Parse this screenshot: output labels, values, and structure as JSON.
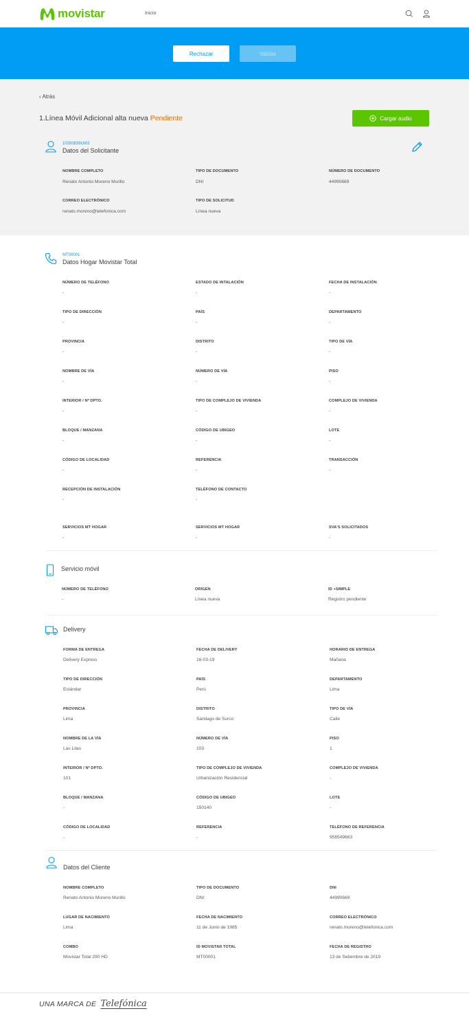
{
  "header": {
    "brand": "movistar",
    "nav_inicio": "Inicio",
    "brand_color": "#5bc500"
  },
  "actions": {
    "reject": "Rechazar",
    "validate": "Validar",
    "band_color": "#019df4"
  },
  "page": {
    "back": "‹ Atrás",
    "title": "1.Línea Móvil Adicional alta nueva",
    "status": "Pendiente",
    "status_color": "#e66c00",
    "upload_audio": "Cargar audio"
  },
  "solicitante": {
    "code": "10283839ch02",
    "title": "Datos del Solicitante",
    "fields": [
      {
        "label": "Nombre completo",
        "value": "Renato Antonio Moreno Murillo"
      },
      {
        "label": "Tipo de documento",
        "value": "DNI"
      },
      {
        "label": "Número de documento",
        "value": "44990669"
      },
      {
        "label": "Correo electrónico",
        "value": "renato.moreno@telefonica.com"
      },
      {
        "label": "Tipo de solicitud",
        "value": "Línea nueva"
      }
    ]
  },
  "hogar": {
    "code": "MT00001",
    "title": "Datos Hogar Movistar Total",
    "fields": [
      {
        "label": "Número de teléfono",
        "value": "-"
      },
      {
        "label": "Estado de intalación",
        "value": "-"
      },
      {
        "label": "Fecha de instalación",
        "value": "-"
      },
      {
        "label": "Tipo de dirección",
        "value": "-"
      },
      {
        "label": "País",
        "value": "-"
      },
      {
        "label": "Departamento",
        "value": "-"
      },
      {
        "label": "Provincia",
        "value": "-"
      },
      {
        "label": "Distrito",
        "value": "-"
      },
      {
        "label": "Tipo de vía",
        "value": "-"
      },
      {
        "label": "Nombre de vía",
        "value": "-"
      },
      {
        "label": "Número de vía",
        "value": "-"
      },
      {
        "label": "Piso",
        "value": "-"
      },
      {
        "label": "Interior / Nº Dpto.",
        "value": "-"
      },
      {
        "label": "Tipo de complejo de vivienda",
        "value": "-"
      },
      {
        "label": "Complejo de vivienda",
        "value": "-"
      },
      {
        "label": "Bloque / Manzana",
        "value": "-"
      },
      {
        "label": "Código de ubigeo",
        "value": "-"
      },
      {
        "label": "Lote",
        "value": "-"
      },
      {
        "label": "Código de localidad",
        "value": "-"
      },
      {
        "label": "Referencia",
        "value": "-"
      },
      {
        "label": "Transacción",
        "value": "-"
      },
      {
        "label": "Recepción de instalación",
        "value": "-"
      },
      {
        "label": "Teléfono de contacto",
        "value": "-"
      },
      {
        "label": "Servicios MT Hogar",
        "value": "-"
      },
      {
        "label": "Servicios MT Hogar",
        "value": "-"
      },
      {
        "label": "SVA's solicitados",
        "value": "-"
      }
    ]
  },
  "movil": {
    "title": "Servicio móvil",
    "fields": [
      {
        "label": "Número de teléfono",
        "value": "-"
      },
      {
        "label": "Origen",
        "value": "Línea nueva"
      },
      {
        "label": "ID +Simple",
        "value": "Registro pendiente"
      }
    ]
  },
  "delivery": {
    "title": "Delivery",
    "fields": [
      {
        "label": "Forma de entrega",
        "value": "Delivery Express"
      },
      {
        "label": "Fecha de delivery",
        "value": "16-03-19"
      },
      {
        "label": "Horario de entrega",
        "value": "Mañana"
      },
      {
        "label": "Tipo de dirección",
        "value": "Estándar"
      },
      {
        "label": "País",
        "value": "Perú"
      },
      {
        "label": "Departamento",
        "value": "Lima"
      },
      {
        "label": "Provincia",
        "value": "Lima"
      },
      {
        "label": "Distrito",
        "value": "Santiago de Surco"
      },
      {
        "label": "Tipo de vía",
        "value": "Calle"
      },
      {
        "label": "Nombre de la vía",
        "value": "Las Lilas"
      },
      {
        "label": "Número de vía",
        "value": "103"
      },
      {
        "label": "Piso",
        "value": "1"
      },
      {
        "label": "Interior / Nº Dpto.",
        "value": "101"
      },
      {
        "label": "Tipo de complejo de vivienda",
        "value": "Urbanización Residencial"
      },
      {
        "label": "Complejo de vivienda",
        "value": "-"
      },
      {
        "label": "Bloque / Manzana",
        "value": "-"
      },
      {
        "label": "Código de ubigeo",
        "value": "150140"
      },
      {
        "label": "Lote",
        "value": "-"
      },
      {
        "label": "Código de localidad",
        "value": "-"
      },
      {
        "label": "Referencia",
        "value": "-"
      },
      {
        "label": "Teléfono de referencia",
        "value": "956549663"
      }
    ]
  },
  "cliente": {
    "title": "Datos del Cliente",
    "fields": [
      {
        "label": "Nombre completo",
        "value": "Renato Antonio Moreno Murillo"
      },
      {
        "label": "Tipo de documento",
        "value": "DNI"
      },
      {
        "label": "DNI",
        "value": "44990669"
      },
      {
        "label": "Lugar de nacimiento",
        "value": "Lima"
      },
      {
        "label": "Fecha de nacimiento",
        "value": "11 de Junio de 1985"
      },
      {
        "label": "Correo electrónico",
        "value": "renato.moreno@telefonica.com"
      },
      {
        "label": "Combo",
        "value": "Movistar Total 290 HD"
      },
      {
        "label": "ID Movistar Total",
        "value": "MT00001"
      },
      {
        "label": "Fecha de registro",
        "value": "13 de Setiembre de 2019"
      }
    ]
  },
  "footer": {
    "text": "UNA MARCA DE",
    "brand": "Telefónica"
  }
}
